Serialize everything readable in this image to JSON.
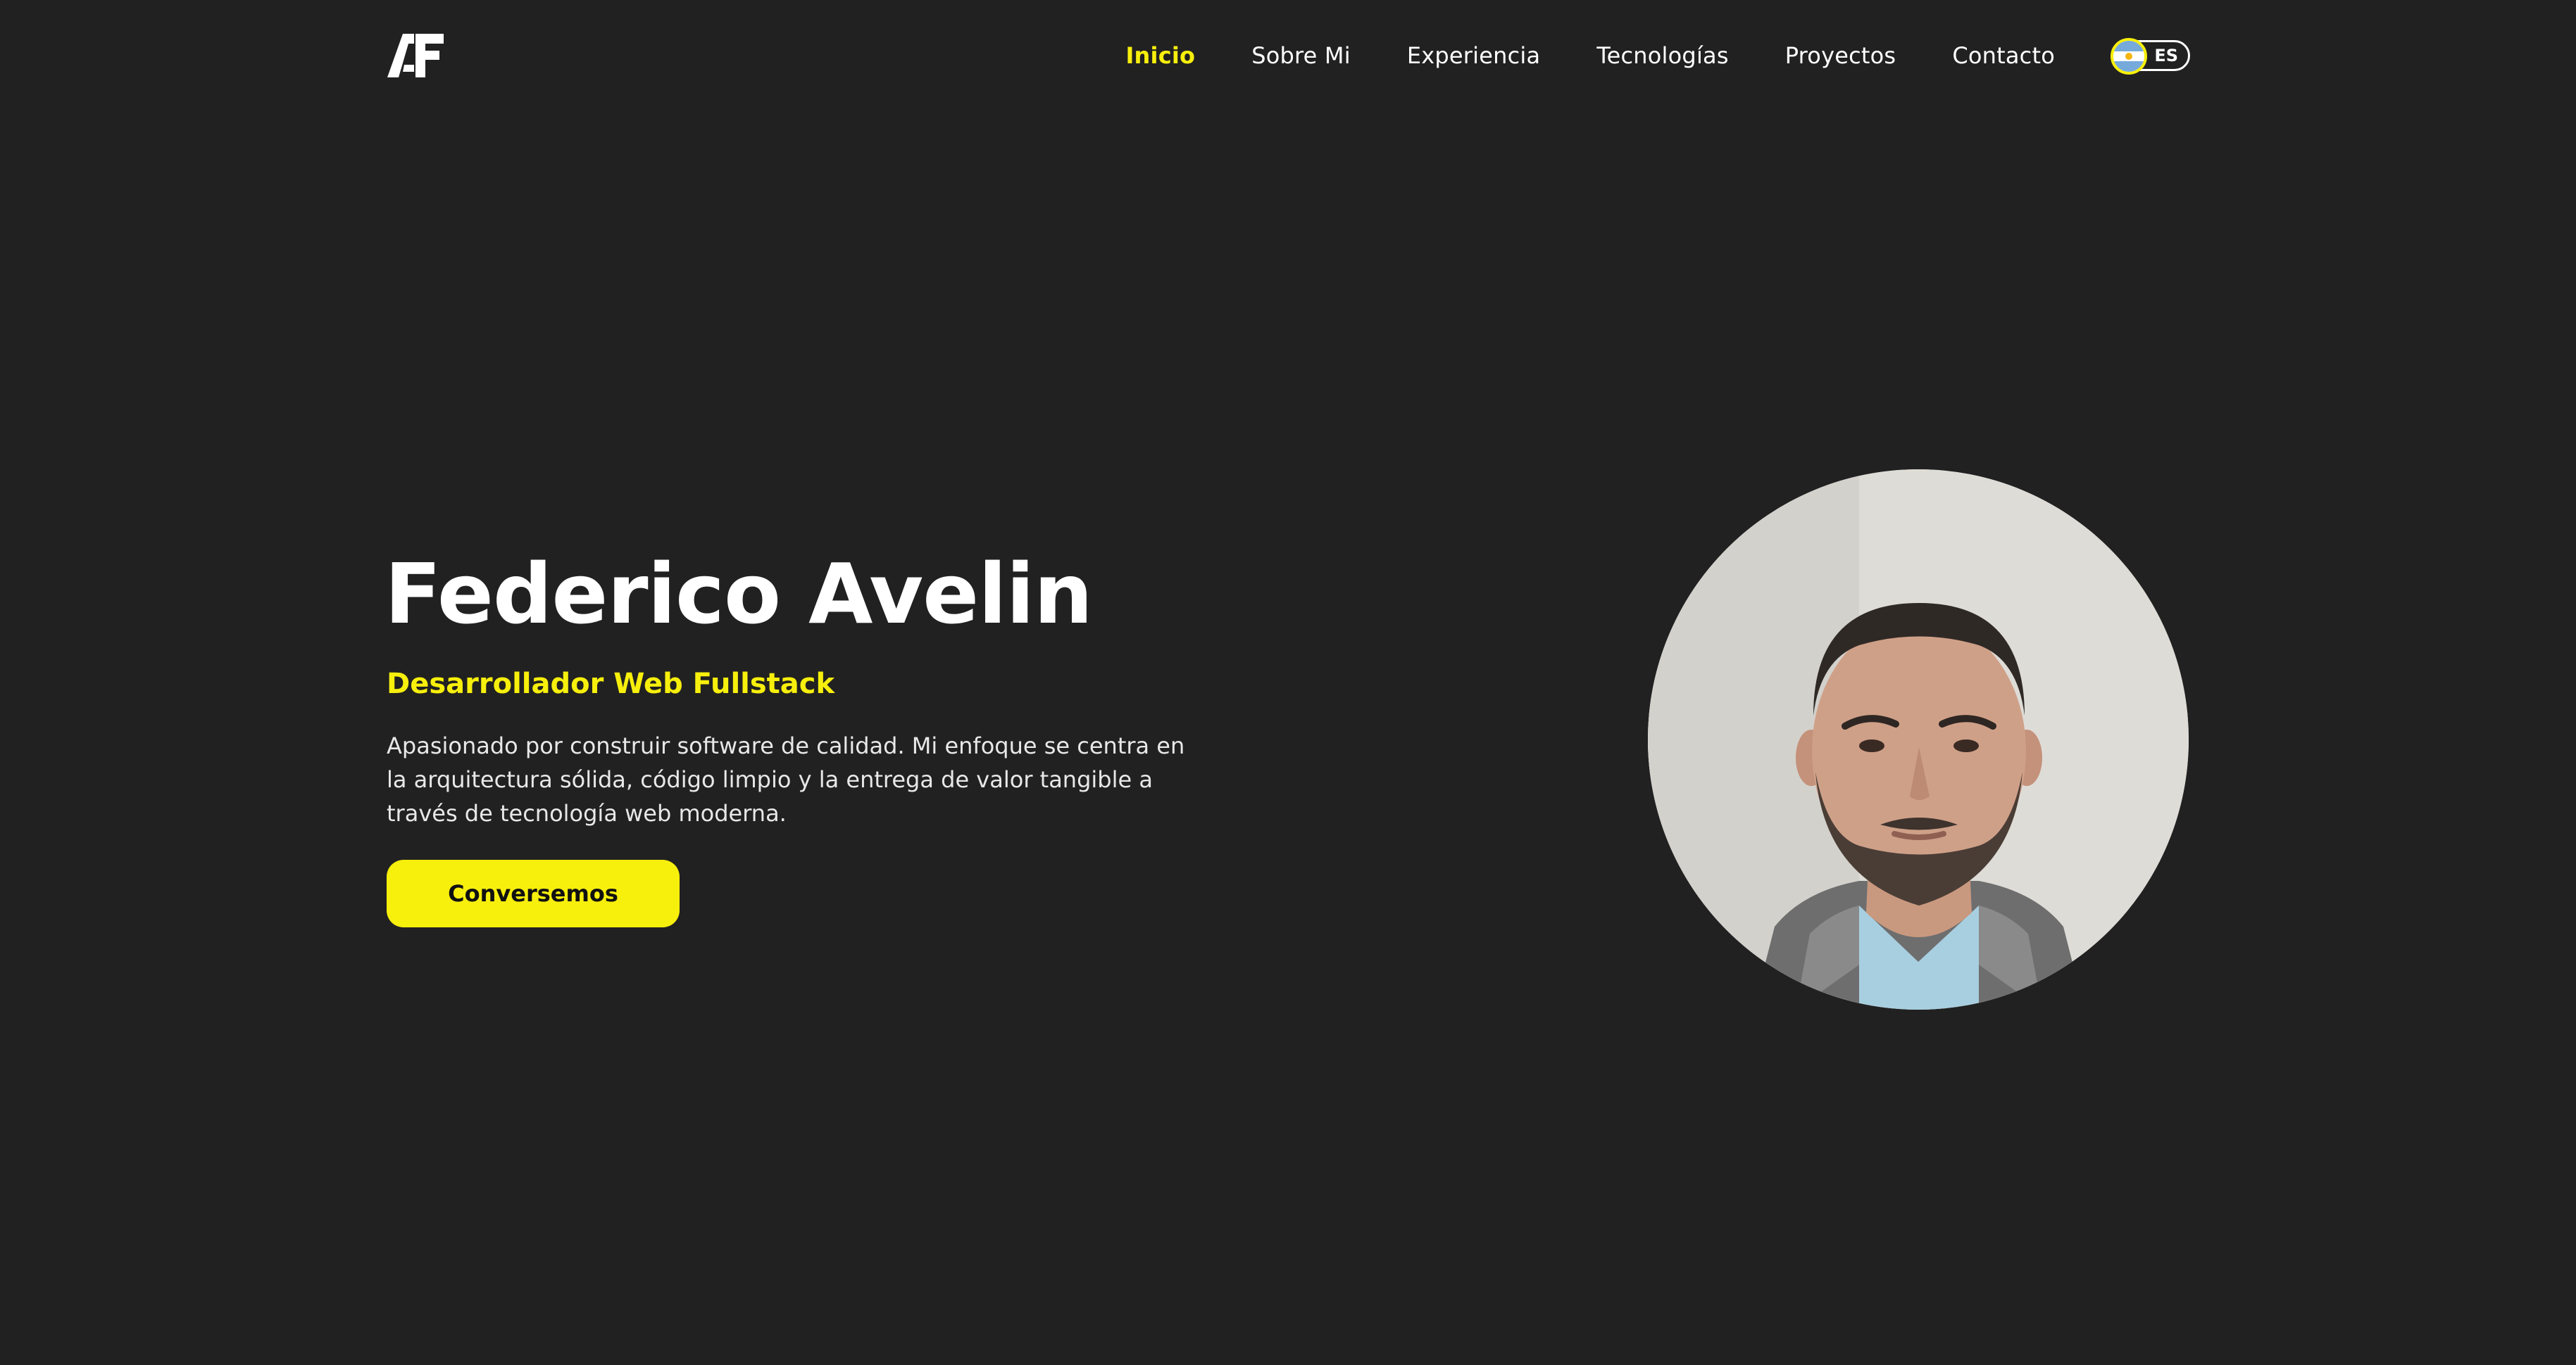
{
  "header": {
    "logo_text": "AF",
    "nav": [
      {
        "label": "Inicio",
        "active": true
      },
      {
        "label": "Sobre Mi",
        "active": false
      },
      {
        "label": "Experiencia",
        "active": false
      },
      {
        "label": "Tecnologías",
        "active": false
      },
      {
        "label": "Proyectos",
        "active": false
      },
      {
        "label": "Contacto",
        "active": false
      }
    ],
    "language": {
      "label": "ES",
      "flag_icon": "argentina-flag-icon"
    }
  },
  "hero": {
    "name": "Federico Avelin",
    "role": "Desarrollador Web Fullstack",
    "description": "Apasionado por construir software de calidad. Mi enfoque se centra en la arquitectura sólida, código limpio y la entrega de valor tangible a través de tecnología web moderna.",
    "cta_label": "Conversemos"
  },
  "colors": {
    "background": "#212121",
    "accent": "#f7ef0c",
    "text": "#ffffff"
  }
}
